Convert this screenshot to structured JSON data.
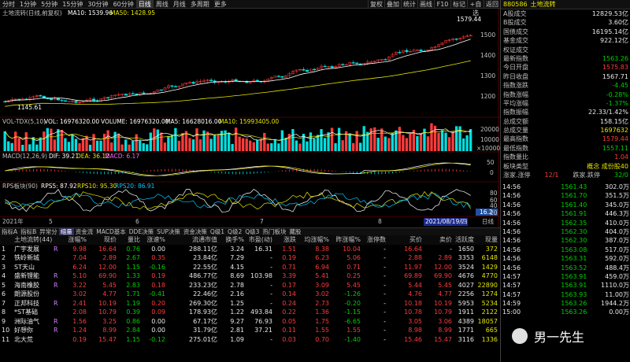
{
  "periods": [
    "分时",
    "1分钟",
    "5分钟",
    "15分钟",
    "30分钟",
    "60分钟",
    "日线",
    "周线",
    "月线",
    "多周期",
    "更多"
  ],
  "active_period": "日线",
  "tools": [
    "复权",
    "叠加",
    "统计",
    "画线",
    "F10",
    "标记",
    "+自选",
    "返回"
  ],
  "price_panel": {
    "label": "土地流转(日线,前复权)",
    "ma10": "MA10: 1539.96",
    "ma50": "MA50: 1428.95",
    "high_mark": "1579.44",
    "low_mark": "1145.61",
    "ticks": [
      "1500",
      "1400",
      "1300",
      "1200"
    ]
  },
  "volume_panel": {
    "label": "VOL-TDX(5,10)",
    "vol": "VOL: 16976320.00",
    "volume": "VOLUME: 16976320.00",
    "ma5": "MA5: 16628016.00",
    "ma10": "MA10: 15993405.00",
    "ticks": [
      "20000",
      "10000",
      "×10000"
    ]
  },
  "macd_panel": {
    "label": "MACD(12,26,9)",
    "dif": "DIF: 39.21",
    "dea": "DEA: 36.12",
    "macd": "MACD: 6.17",
    "ticks": [
      "50",
      "0"
    ]
  },
  "rps_panel": {
    "label": "RPS板块(90)",
    "rps5": "RPS5: 87.92",
    "rps10": "RPS10: 95.30",
    "rps20": "RPS20: 86.91",
    "ticks": [
      "80",
      "60",
      "40",
      "20"
    ],
    "badge": "16.2"
  },
  "date_axis": {
    "start": "2021年",
    "mid_labels": [
      "5",
      "6",
      "7",
      "8"
    ],
    "highlight": "2021/08/19/四",
    "end": "日线"
  },
  "bottom_tabs": [
    "指标A",
    "指标B",
    "异常分",
    "缩量",
    "资金流",
    "MACD基本",
    "DDE决策",
    "SUP决策",
    "资金决策",
    "Q级1",
    "Q级2",
    "Q级3",
    "热门板块",
    "藏股"
  ],
  "table": {
    "headers": [
      "土地流转(44)",
      "涨幅%",
      "现价",
      "量比",
      "涨速%",
      "流通市值",
      "换手%",
      "市盈(动)",
      "涨跌",
      "均涨幅%",
      "昨涨幅%",
      "涨停数",
      "买价",
      "卖价",
      "活跃度",
      "现量"
    ],
    "rows": [
      {
        "n": "1",
        "mark": "",
        "name": "广宇发展",
        "flag": "R",
        "pct": "9.98",
        "price": "16.64",
        "vr": "0.76",
        "spd": "0.00",
        "cap": "288.11亿",
        "turn": "3.24",
        "pe": "16.31",
        "chg": "1.51",
        "avg": "8.38",
        "yday": "10.04",
        "lim": "-",
        "bid": "16.64",
        "ask": "-",
        "act": "1650",
        "vol": "372"
      },
      {
        "n": "2",
        "mark": "",
        "name": "铁岭新城",
        "flag": "",
        "pct": "7.04",
        "price": "2.89",
        "vr": "2.67",
        "spd": "0.35",
        "cap": "23.84亿",
        "turn": "7.29",
        "pe": "-",
        "chg": "0.19",
        "avg": "6.23",
        "yday": "5.06",
        "lim": "-",
        "bid": "2.88",
        "ask": "2.89",
        "act": "3353",
        "vol": "6148"
      },
      {
        "n": "3",
        "mark": "",
        "name": "ST天山",
        "flag": "",
        "pct": "6.24",
        "price": "12.00",
        "vr": "1.15",
        "spd": "-0.16",
        "cap": "22.55亿",
        "turn": "4.15",
        "pe": "-",
        "chg": "0.71",
        "avg": "6.94",
        "yday": "0.71",
        "lim": "-",
        "bid": "11.97",
        "ask": "12.00",
        "act": "3524",
        "vol": "1429"
      },
      {
        "n": "4",
        "mark": "",
        "name": "盛新锂能",
        "flag": "R",
        "pct": "5.10",
        "price": "69.90",
        "vr": "1.33",
        "spd": "0.19",
        "cap": "486.77亿",
        "turn": "8.69",
        "pe": "103.98",
        "chg": "3.39",
        "avg": "5.41",
        "yday": "0.25",
        "lim": "-",
        "bid": "69.89",
        "ask": "69.90",
        "act": "4676",
        "vol": "4770"
      },
      {
        "n": "5",
        "mark": "",
        "name": "海南橡胶",
        "flag": "R",
        "pct": "3.22",
        "price": "5.45",
        "vr": "2.83",
        "spd": "0.18",
        "cap": "233.23亿",
        "turn": "2.78",
        "pe": "-",
        "chg": "0.17",
        "avg": "3.09",
        "yday": "5.45",
        "lim": "-",
        "bid": "5.44",
        "ask": "5.45",
        "act": "4027",
        "vol": "22890"
      },
      {
        "n": "6",
        "mark": "",
        "name": "朗源股份",
        "flag": "",
        "pct": "3.02",
        "price": "4.77",
        "vr": "1.71",
        "spd": "-0.41",
        "cap": "22.46亿",
        "turn": "2.16",
        "pe": "-",
        "chg": "0.14",
        "avg": "3.02",
        "yday": "-1.26",
        "lim": "-",
        "bid": "4.76",
        "ask": "4.77",
        "act": "2256",
        "vol": "1274"
      },
      {
        "n": "7",
        "mark": "",
        "name": "正邦科技",
        "flag": "R",
        "pct": "2.41",
        "price": "10.19",
        "vr": "1.19",
        "spd": "0.20",
        "cap": "269.30亿",
        "turn": "1.25",
        "pe": "-",
        "chg": "0.24",
        "avg": "2.73",
        "yday": "-0.20",
        "lim": "-",
        "bid": "10.18",
        "ask": "10.19",
        "act": "5953",
        "vol": "5234"
      },
      {
        "n": "8",
        "mark": "",
        "name": "*ST基础",
        "flag": "",
        "pct": "2.08",
        "price": "10.79",
        "vr": "0.39",
        "spd": "0.09",
        "cap": "178.93亿",
        "turn": "1.22",
        "pe": "493.84",
        "chg": "0.22",
        "avg": "1.36",
        "yday": "-1.15",
        "lim": "-",
        "bid": "10.78",
        "ask": "10.79",
        "act": "1911",
        "vol": "2122"
      },
      {
        "n": "9",
        "mark": "",
        "name": "洲际油气",
        "flag": "R",
        "pct": "1.56",
        "price": "3.25",
        "vr": "0.86",
        "spd": "0.00",
        "cap": "67.17亿",
        "turn": "9.27",
        "pe": "76.93",
        "chg": "0.05",
        "avg": "1.75",
        "yday": "-6.65",
        "lim": "-",
        "bid": "3.05",
        "ask": "3.06",
        "act": "4389",
        "vol": "18057"
      },
      {
        "n": "10",
        "mark": "",
        "name": "好想你",
        "flag": "R",
        "pct": "1.24",
        "price": "8.99",
        "vr": "2.84",
        "spd": "0.00",
        "cap": "31.79亿",
        "turn": "2.81",
        "pe": "37.21",
        "chg": "0.11",
        "avg": "1.55",
        "yday": "1.55",
        "lim": "-",
        "bid": "8.98",
        "ask": "8.99",
        "act": "1771",
        "vol": "665"
      },
      {
        "n": "11",
        "mark": "",
        "name": "北大荒",
        "flag": "",
        "pct": "0.19",
        "price": "15.47",
        "vr": "1.15",
        "spd": "-0.12",
        "cap": "275.01亿",
        "turn": "1.09",
        "pe": "-",
        "chg": "0.03",
        "avg": "0.70",
        "yday": "-1.40",
        "lim": "-",
        "bid": "15.46",
        "ask": "15.47",
        "act": "3116",
        "vol": "1336"
      }
    ]
  },
  "right_panel": {
    "code": "880586",
    "name": "土地流转",
    "stats": [
      {
        "k": "A股成交",
        "v": "12829.53亿",
        "c": "white"
      },
      {
        "k": "B股成交",
        "v": "3.60亿",
        "c": "white"
      },
      {
        "k": "国债成交",
        "v": "16195.14亿",
        "c": "white"
      },
      {
        "k": "基金成交",
        "v": "922.12亿",
        "c": "white"
      },
      {
        "k": "权证成交",
        "v": "",
        "c": "white"
      },
      {
        "k": "最新指数",
        "v": "1563.26",
        "c": "green"
      },
      {
        "k": "今日开盘",
        "v": "1575.83",
        "c": "red"
      },
      {
        "k": "昨日收盘",
        "v": "1567.71",
        "c": "white"
      },
      {
        "k": "指数涨跌",
        "v": "-4.45",
        "c": "green"
      },
      {
        "k": "指数涨幅",
        "v": "-0.28%",
        "c": "green"
      },
      {
        "k": "平均涨幅",
        "v": "-1.37%",
        "c": "green"
      },
      {
        "k": "指数振幅",
        "v": "22.33/1.42%",
        "c": "white"
      },
      {
        "k": "总成交额",
        "v": "158.15亿",
        "c": "white"
      },
      {
        "k": "总成交量",
        "v": "1697632",
        "c": "yellow"
      },
      {
        "k": "最高指数",
        "v": "1579.44",
        "c": "red"
      },
      {
        "k": "最低指数",
        "v": "1557.11",
        "c": "green"
      },
      {
        "k": "指数量比",
        "v": "1.04",
        "c": "red"
      }
    ],
    "type_label": "板块类型",
    "type_value": "概念 成份股40",
    "updown": "涨家.涨停",
    "updown_val": "12/1",
    "down": "跌家.跌停",
    "down_val": "32/0",
    "ticks": [
      {
        "t": "14:56",
        "p": "1561.43",
        "v": "302.0万"
      },
      {
        "t": "14:56",
        "p": "1561.70",
        "v": "351.5万"
      },
      {
        "t": "14:56",
        "p": "1561.40",
        "v": "345.0万"
      },
      {
        "t": "14:56",
        "p": "1561.91",
        "v": "446.3万"
      },
      {
        "t": "14:56",
        "p": "1562.35",
        "v": "410.0万"
      },
      {
        "t": "14:56",
        "p": "1562.30",
        "v": "404.0万"
      },
      {
        "t": "14:56",
        "p": "1562.30",
        "v": "387.0万"
      },
      {
        "t": "14:56",
        "p": "1563.08",
        "v": "517.0万"
      },
      {
        "t": "14:56",
        "p": "1563.31",
        "v": "592.0万"
      },
      {
        "t": "14:56",
        "p": "1563.52",
        "v": "488.4万"
      },
      {
        "t": "14:57",
        "p": "1563.91",
        "v": "459.0万"
      },
      {
        "t": "14:57",
        "p": "1563.91",
        "v": "1110.0万"
      },
      {
        "t": "14:57",
        "p": "1563.93",
        "v": "11.00万"
      },
      {
        "t": "14:59",
        "p": "1563.26",
        "v": "1944.2万"
      },
      {
        "t": "15:00",
        "p": "1563.26",
        "v": "0.00万"
      }
    ]
  },
  "watermark": "男一先生"
}
